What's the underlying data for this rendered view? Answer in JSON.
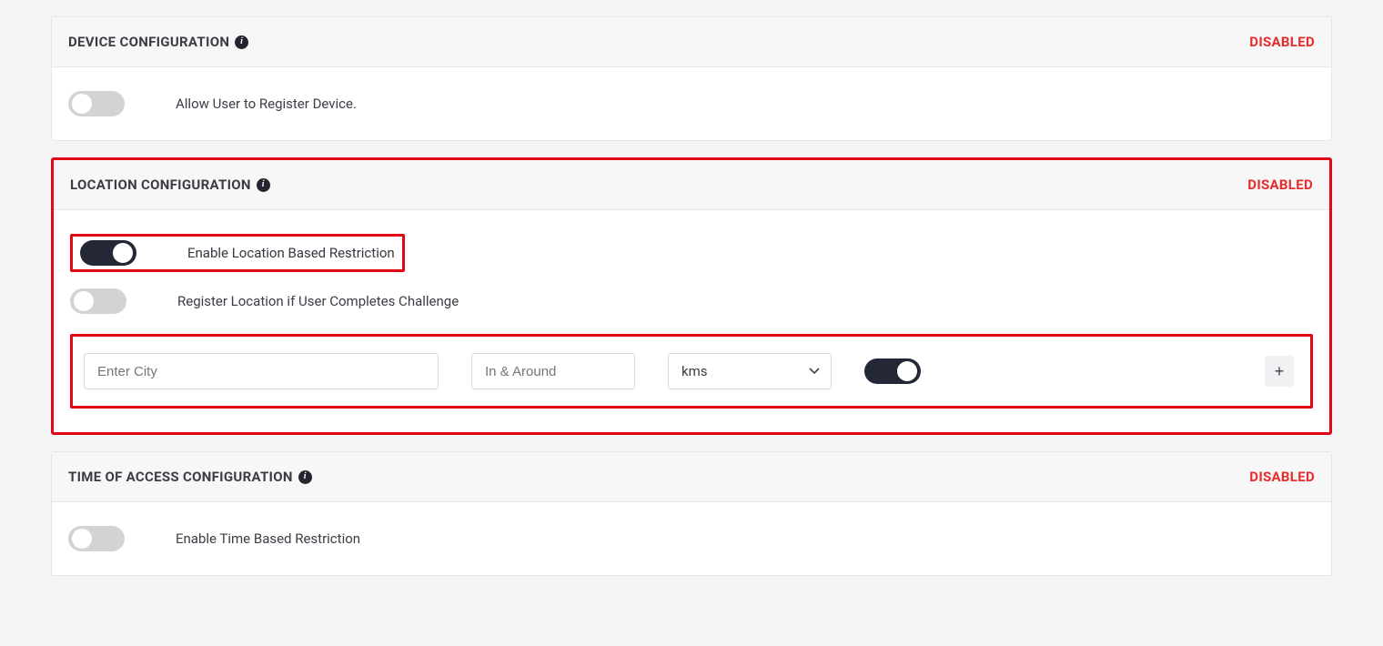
{
  "sections": {
    "device": {
      "title": "DEVICE CONFIGURATION",
      "status": "DISABLED",
      "allow_register_label": "Allow User to Register Device."
    },
    "location": {
      "title": "LOCATION CONFIGURATION",
      "status": "DISABLED",
      "enable_label": "Enable Location Based Restriction",
      "register_label": "Register Location if User Completes Challenge",
      "city_placeholder": "Enter City",
      "around_placeholder": "In & Around",
      "unit_selected": "kms",
      "add_label": "+"
    },
    "time": {
      "title": "TIME OF ACCESS CONFIGURATION",
      "status": "DISABLED",
      "enable_label": "Enable Time Based Restriction"
    }
  }
}
